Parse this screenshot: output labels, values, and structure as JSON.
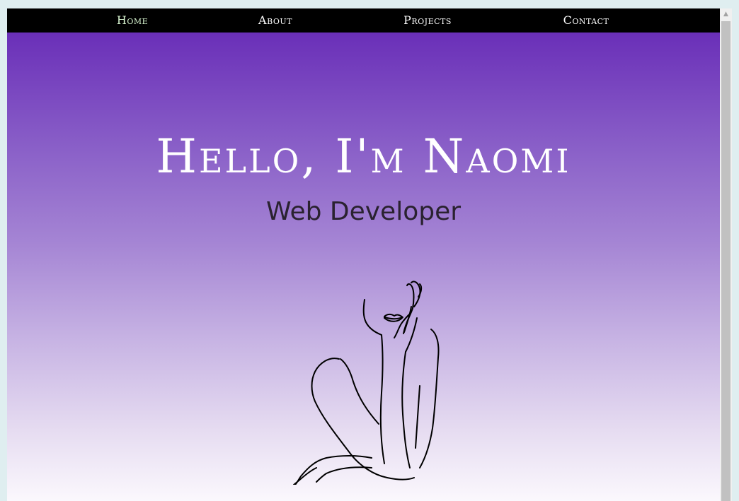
{
  "nav": {
    "items": [
      {
        "label": "Home"
      },
      {
        "label": "About"
      },
      {
        "label": "Projects"
      },
      {
        "label": "Contact"
      }
    ]
  },
  "hero": {
    "title": "Hello, I'm Naomi",
    "subtitle": "Web Developer",
    "illustration_icon": "line-art-woman-illustration"
  },
  "colors": {
    "nav_background": "#000000",
    "gradient_top": "#6a2fb8",
    "gradient_bottom": "#fbf8fd",
    "title_color": "#ffffff",
    "subtitle_color": "#2a2230"
  }
}
